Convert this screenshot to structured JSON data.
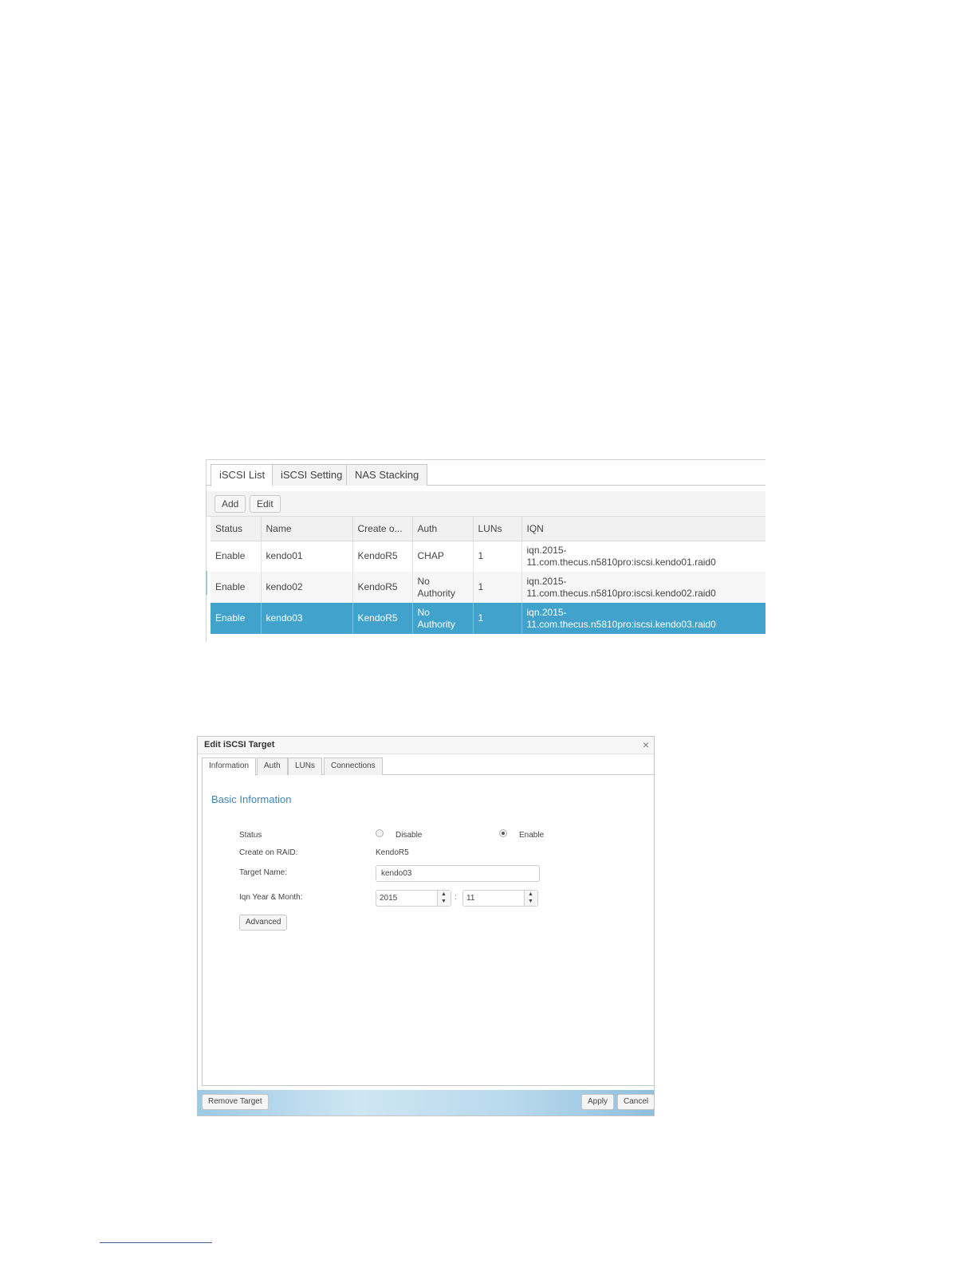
{
  "iscsi_list": {
    "tabs": [
      "iSCSI List",
      "iSCSI Setting",
      "NAS Stacking"
    ],
    "toolbar": {
      "add_label": "Add",
      "edit_label": "Edit"
    },
    "columns": [
      "Status",
      "Name",
      "Create o...",
      "Auth",
      "LUNs",
      "IQN"
    ],
    "rows": [
      {
        "status": "Enable",
        "name": "kendo01",
        "create_on": "KendoR5",
        "auth": "CHAP",
        "luns": "1",
        "iqn_line1": "iqn.2015-",
        "iqn_line2": "11.com.thecus.n5810pro:iscsi.kendo01.raid0"
      },
      {
        "status": "Enable",
        "name": "kendo02",
        "create_on": "KendoR5",
        "auth_line1": "No",
        "auth_line2": "Authority",
        "luns": "1",
        "iqn_line1": "iqn.2015-",
        "iqn_line2": "11.com.thecus.n5810pro:iscsi.kendo02.raid0"
      },
      {
        "status": "Enable",
        "name": "kendo03",
        "create_on": "KendoR5",
        "auth_line1": "No",
        "auth_line2": "Authority",
        "luns": "1",
        "iqn_line1": "iqn.2015-",
        "iqn_line2": "11.com.thecus.n5810pro:iscsi.kendo03.raid0"
      }
    ],
    "selected_row_color": "#41a3cc"
  },
  "edit_dialog": {
    "title": "Edit iSCSI Target",
    "close_icon": "close-icon",
    "tabs": [
      "Information",
      "Auth",
      "LUNs",
      "Connections"
    ],
    "section_title": "Basic Information",
    "status_label": "Status",
    "status_options": [
      "Disable",
      "Enable"
    ],
    "status_selected": "Enable",
    "raid_label": "Create on RAID:",
    "raid_value": "KendoR5",
    "target_name_label": "Target Name:",
    "target_name_value": "kendo03",
    "iqn_label": "Iqn Year & Month:",
    "iqn_year": "2015",
    "iqn_month": "11",
    "iqn_separator": ":",
    "advanced_label": "Advanced",
    "remove_label": "Remove Target",
    "apply_label": "Apply",
    "cancel_label": "Cancel",
    "accent_color": "#3d84b8"
  }
}
